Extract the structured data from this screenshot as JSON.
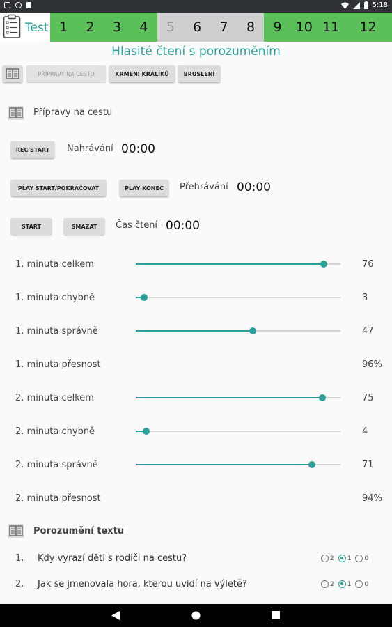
{
  "status_bar": {
    "time": "5:18"
  },
  "header": {
    "title": "Test",
    "numbers": [
      {
        "label": "1",
        "state": "green"
      },
      {
        "label": "2",
        "state": "green"
      },
      {
        "label": "3",
        "state": "green"
      },
      {
        "label": "4",
        "state": "green"
      },
      {
        "label": "5",
        "state": "current"
      },
      {
        "label": "6",
        "state": "grey"
      },
      {
        "label": "7",
        "state": "grey"
      },
      {
        "label": "8",
        "state": "grey"
      },
      {
        "label": "9",
        "state": "green"
      },
      {
        "label": "10",
        "state": "green"
      },
      {
        "label": "11",
        "state": "green"
      },
      {
        "label": "12",
        "state": "green"
      }
    ],
    "colors": {
      "green": "#5cc05a",
      "grey": "#cfcfcf",
      "current_text": "#9a9a9a",
      "accent": "#2aa09a"
    }
  },
  "subtitle": "Hlasité čtení s porozuměním",
  "story_tabs": [
    "PŘÍPRAVY NA CESTU",
    "KRMENÍ KRÁLÍKŮ",
    "BRUSLENÍ"
  ],
  "section1_title": "Přípravy na cestu",
  "recording": {
    "rec_button": "REC START",
    "rec_label": "Nahrávání",
    "rec_time": "00:00",
    "play_button": "PLAY START/POKRAČOVAT",
    "stop_button": "PLAY KONEC",
    "play_label": "Přehrávání",
    "play_time": "00:00",
    "start_button": "START",
    "clear_button": "SMAZAT",
    "reading_label": "Čas čtení",
    "reading_time": "00:00"
  },
  "stats": [
    {
      "label": "1. minuta celkem",
      "value": "76",
      "fraction": 0.92
    },
    {
      "label": "1. minuta chybně",
      "value": "3",
      "fraction": 0.04
    },
    {
      "label": "1. minuta správně",
      "value": "47",
      "fraction": 0.57
    },
    {
      "label": "1. minuta přesnost",
      "value": "96%"
    },
    {
      "label": "2. minuta celkem",
      "value": "75",
      "fraction": 0.91
    },
    {
      "label": "2. minuta chybně",
      "value": "4",
      "fraction": 0.05
    },
    {
      "label": "2. minuta správně",
      "value": "71",
      "fraction": 0.86
    },
    {
      "label": "2. minuta přesnost",
      "value": "94%"
    }
  ],
  "section2_title": "Porozumění textu",
  "questions": [
    {
      "num": "1.",
      "text": "Kdy vyrazí děti s rodiči na cestu?",
      "options": [
        "2",
        "1",
        "0"
      ],
      "selected": "1"
    },
    {
      "num": "2.",
      "text": "Jak se jmenovala hora, kterou uvidí na výletě?",
      "options": [
        "2",
        "1",
        "0"
      ],
      "selected": "1"
    }
  ]
}
